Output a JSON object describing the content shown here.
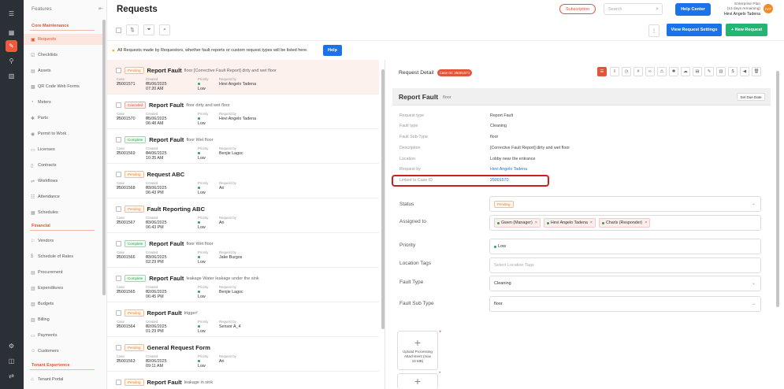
{
  "rail": {
    "icons": [
      "menu-icon",
      "dashboard-icon",
      "maintenance-icon",
      "org-icon",
      "reports-icon",
      "settings-icon",
      "box-icon",
      "user-swap-icon"
    ]
  },
  "sidebar": {
    "header": "Features",
    "sections": [
      {
        "label": "Core Maintenance"
      },
      {
        "label": "Financial"
      },
      {
        "label": "Tenant Experience"
      }
    ],
    "items": [
      {
        "label": "Requests"
      },
      {
        "label": "Checklists"
      },
      {
        "label": "Assets"
      },
      {
        "label": "QR Code Web Forms"
      },
      {
        "label": "Meters"
      },
      {
        "label": "Parts"
      },
      {
        "label": "Permit to Work"
      },
      {
        "label": "Licenses"
      },
      {
        "label": "Contracts"
      },
      {
        "label": "Workflows"
      },
      {
        "label": "Attendance"
      },
      {
        "label": "Schedules"
      },
      {
        "label": "Vendors"
      },
      {
        "label": "Schedule of Rates"
      },
      {
        "label": "Procurement"
      },
      {
        "label": "Expenditures"
      },
      {
        "label": "Budgets"
      },
      {
        "label": "Billing"
      },
      {
        "label": "Payments"
      },
      {
        "label": "Customers"
      },
      {
        "label": "Tenant Portal"
      }
    ]
  },
  "header": {
    "title": "Requests",
    "subscription": "Subscription",
    "search_placeholder": "Search",
    "help_center": "Help Center",
    "plan_line1": "Enterprise Plan",
    "plan_line2": "(13 days remaining)",
    "user_name": "Hevi Angelo Tadena",
    "avatar_initials": "HAT"
  },
  "toolbar": {
    "view_settings": "View Request Settings",
    "new_request": "+ New Request"
  },
  "info": {
    "text": "All Requests made by Requestors, whether fault reports or custom request types will be listed here.",
    "help": "Help"
  },
  "list_labels": {
    "case_id": "Case ID",
    "created_at": "Created at",
    "priority": "Priority",
    "request_by": "Request by"
  },
  "requests": [
    {
      "status": "Pending",
      "title": "Report Fault",
      "sub": "floor [Corrective Fault Report] dirty and wet floor",
      "case_id": "25001571",
      "created": "05/06/2025 07:20 AM",
      "priority": "Low",
      "by": "Hevi Angelo Tadena"
    },
    {
      "status": "Canceled",
      "title": "Report Fault",
      "sub": "floor dirty and wet floor",
      "case_id": "25001570",
      "created": "05/06/2025 06:48 AM",
      "priority": "Low",
      "by": "Hevi Angelo Tadena"
    },
    {
      "status": "Complete",
      "title": "Report Fault",
      "sub": "floor Wet floor",
      "case_id": "25001569",
      "created": "04/06/2025 10:35 AM",
      "priority": "Low",
      "by": "Benjie Lagoc"
    },
    {
      "status": "Pending",
      "title": "Request ABC",
      "sub": "",
      "case_id": "25001568",
      "created": "03/06/2025 06:43 PM",
      "priority": "Low",
      "by": "Ari"
    },
    {
      "status": "Pending",
      "title": "Fault Reporting ABC",
      "sub": "",
      "case_id": "25001567",
      "created": "03/06/2025 06:43 PM",
      "priority": "Low",
      "by": "Ari"
    },
    {
      "status": "Complete",
      "title": "Report Fault",
      "sub": "floor Wet floor",
      "case_id": "25001566",
      "created": "03/06/2025 02:29 PM",
      "priority": "Low",
      "by": "Jake Burgos"
    },
    {
      "status": "Complete",
      "title": "Report Fault",
      "sub": "leakage Water leakage under the sink",
      "case_id": "25001565",
      "created": "02/06/2025 06:45 PM",
      "priority": "Low",
      "by": "Benjie Lagoc"
    },
    {
      "status": "Pending",
      "title": "Report Fault",
      "sub": "trigger!",
      "case_id": "25001564",
      "created": "02/06/2025 01:29 PM",
      "priority": "Low",
      "by": "Sensor A_4"
    },
    {
      "status": "Pending",
      "title": "General Request Form",
      "sub": "",
      "case_id": "25001563",
      "created": "02/06/2025 09:11 AM",
      "priority": "Low",
      "by": "Ari"
    },
    {
      "status": "Pending",
      "title": "Report Fault",
      "sub": "leakage in sink",
      "case_id": "",
      "created": "",
      "priority": "",
      "by": ""
    }
  ],
  "detail": {
    "title": "Request Detail",
    "case_badge": "Case ID: 25001571",
    "band_title": "Report Fault",
    "band_sub": "floor",
    "due_button": "Set Due Date",
    "fields": [
      {
        "k": "Request type",
        "v": "Report Fault"
      },
      {
        "k": "Fault type",
        "v": "Cleaning"
      },
      {
        "k": "Fault Sub-Type",
        "v": "floor"
      },
      {
        "k": "Description",
        "v": "[Corrective Fault Report] dirty and wet floor"
      },
      {
        "k": "Location",
        "v": "Lobby near the entrance"
      },
      {
        "k": "Request by",
        "v": "Hevi Angelo Tadena"
      },
      {
        "k": "Linked to Case ID",
        "v": "25001570"
      }
    ],
    "form": {
      "status_label": "Status",
      "status_value": "Pending",
      "assigned_label": "Assigned to",
      "assignees": [
        "Gwen (Manager)",
        "Hevi Angelo Tadena",
        "Charls (Responder)"
      ],
      "priority_label": "Priority",
      "priority_value": "Low",
      "location_tags_label": "Location Tags",
      "location_tags_placeholder": "Select Location Tags",
      "fault_type_label": "Fault Type",
      "fault_type_value": "Cleaning",
      "fault_subtype_label": "Fault Sub Type",
      "fault_subtype_value": "floor"
    },
    "upload": {
      "plus": "+",
      "line1": "Upload Processing",
      "line2": "Attachment (max",
      "line3": "10 MB)",
      "required": "*"
    }
  }
}
